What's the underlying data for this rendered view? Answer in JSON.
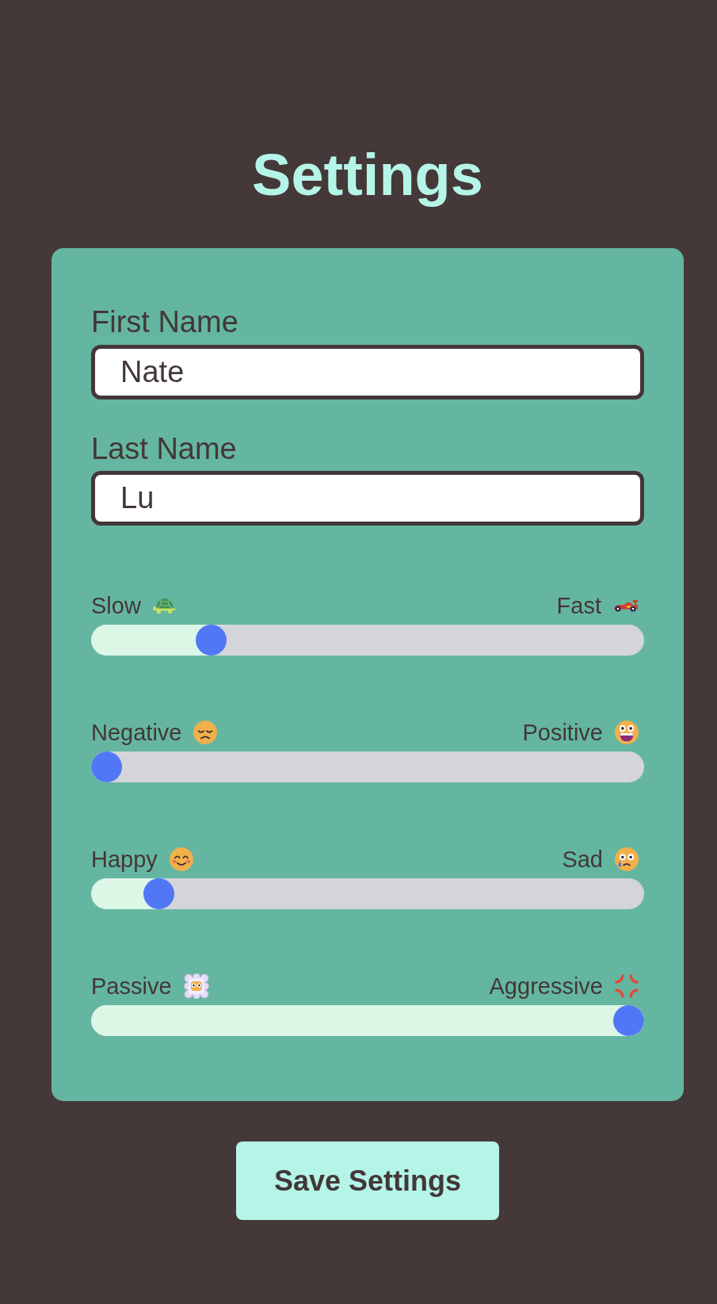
{
  "title": "Settings",
  "fields": [
    {
      "label": "First Name",
      "value": "Nate"
    },
    {
      "label": "Last Name",
      "value": "Lu"
    }
  ],
  "sliders": [
    {
      "left_label": "Slow",
      "right_label": "Fast",
      "level": 0.2
    },
    {
      "left_label": "Negative",
      "right_label": "Positive",
      "level": 0
    },
    {
      "left_label": "Happy",
      "right_label": "Sad",
      "level": 0.1
    },
    {
      "left_label": "Passive",
      "right_label": "Aggressive",
      "level": 1
    }
  ],
  "buttons": [
    "Save Settings"
  ]
}
